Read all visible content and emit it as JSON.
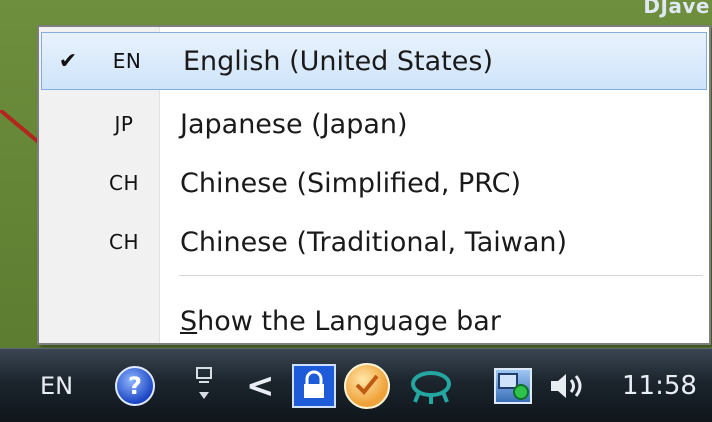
{
  "desktop": {
    "corner_text": "DJave"
  },
  "menu": {
    "items": [
      {
        "code": "EN",
        "label": "English (United States)",
        "checked": true
      },
      {
        "code": "JP",
        "label": "Japanese (Japan)",
        "checked": false
      },
      {
        "code": "CH",
        "label": "Chinese (Simplified, PRC)",
        "checked": false
      },
      {
        "code": "CH",
        "label": "Chinese (Traditional, Taiwan)",
        "checked": false
      }
    ],
    "check_glyph": "✔",
    "show_bar": {
      "accel": "S",
      "rest": "how the Language bar"
    }
  },
  "taskbar": {
    "language": "EN",
    "help_glyph": "?",
    "chevron": "<",
    "time": "11:58",
    "icons": [
      "help-icon",
      "ime-icon",
      "lock-icon",
      "messenger-icon",
      "teal-tray-icon",
      "network-icon",
      "volume-icon"
    ]
  },
  "colors": {
    "desktop": "#5c7c30",
    "selected_fill": "#cfe4fa",
    "selected_border": "#84acdd",
    "taskbar": "#1c252d",
    "arrow": "#b3261e"
  }
}
